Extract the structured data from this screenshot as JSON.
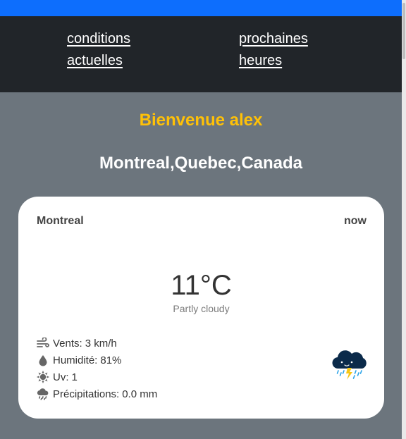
{
  "nav": {
    "conditions_line1": "conditions",
    "conditions_line2": "actuelles",
    "prochaines_line1": "prochaines",
    "prochaines_line2": "heures"
  },
  "welcome": "Bienvenue alex",
  "location": "Montreal,Quebec,Canada",
  "card": {
    "city": "Montreal",
    "time": "now",
    "temperature": "11°C",
    "condition": "Partly cloudy",
    "wind_label": "Vents:",
    "wind_value": "3 km/h",
    "humidity_label": "Humidité:",
    "humidity_value": "81%",
    "uv_label": "Uv:",
    "uv_value": "1",
    "precip_label": "Précipitations:",
    "precip_value": "0.0 mm"
  },
  "icons": {
    "wind": "wind-icon",
    "humidity": "droplet-icon",
    "uv": "sun-icon",
    "precip": "cloud-rain-icon",
    "weather": "thunderstorm-icon"
  },
  "colors": {
    "topbar": "#0d6efd",
    "nav_bg": "#212529",
    "page_bg": "#6c757d",
    "welcome": "#ffc107"
  }
}
